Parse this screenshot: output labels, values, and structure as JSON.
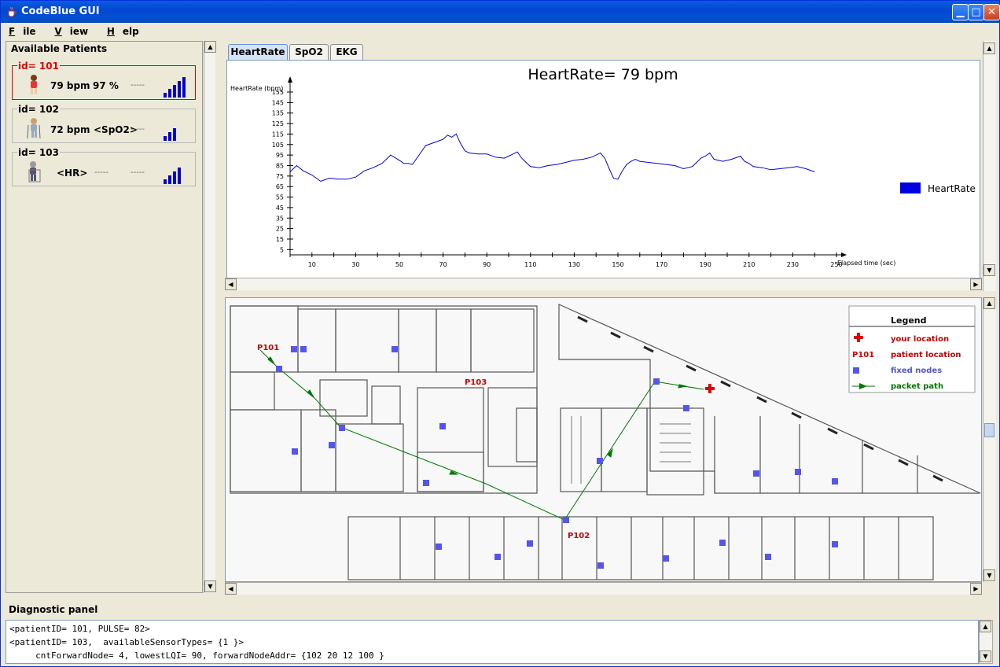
{
  "window": {
    "title": "CodeBlue GUI"
  },
  "menu": [
    {
      "label": "File",
      "u": "F",
      "rest": "ile"
    },
    {
      "label": "View",
      "u": "V",
      "rest": "iew"
    },
    {
      "label": "Help",
      "u": "H",
      "rest": "elp"
    }
  ],
  "patients_panel": {
    "title": "Available Patients",
    "patients": [
      {
        "id_label": "id= 101",
        "value1": "79 bpm",
        "value2": "97 %",
        "value3": "-----",
        "signal_bars": 5,
        "selected": true
      },
      {
        "id_label": "id= 102",
        "value1": "72 bpm",
        "value2": "<SpO2>",
        "value3": "-----",
        "signal_bars": 3,
        "selected": false
      },
      {
        "id_label": "id= 103",
        "value1": "<HR>",
        "value2": "-----",
        "value3": "-----",
        "signal_bars": 4,
        "selected": false
      }
    ]
  },
  "tabs": [
    {
      "label": "HeartRate",
      "active": true
    },
    {
      "label": "SpO2",
      "active": false
    },
    {
      "label": "EKG",
      "active": false
    }
  ],
  "chart_data": {
    "type": "line",
    "title": "HeartRate= 79 bpm",
    "ylabel": "HeartRate (bpm)",
    "xlabel": "Elapsed time (sec)",
    "xlim": [
      0,
      250
    ],
    "ylim": [
      0,
      155
    ],
    "yticks": [
      5,
      15,
      25,
      35,
      45,
      55,
      65,
      75,
      85,
      95,
      105,
      115,
      125,
      135,
      145,
      155
    ],
    "xticks": [
      10,
      30,
      50,
      70,
      90,
      110,
      130,
      150,
      170,
      190,
      210,
      230,
      250
    ],
    "legend": "right",
    "series": [
      {
        "name": "HeartRate",
        "color": "#0000e0",
        "x": [
          0,
          3,
          6,
          10,
          14,
          18,
          22,
          26,
          30,
          34,
          38,
          42,
          46,
          50,
          52,
          54,
          56,
          58,
          62,
          66,
          70,
          72,
          74,
          76,
          78,
          80,
          82,
          86,
          90,
          94,
          98,
          100,
          102,
          104,
          106,
          108,
          110,
          114,
          118,
          122,
          126,
          130,
          134,
          138,
          142,
          144,
          146,
          148,
          150,
          152,
          154,
          156,
          158,
          160,
          164,
          168,
          172,
          176,
          180,
          184,
          186,
          188,
          190,
          192,
          194,
          198,
          202,
          206,
          208,
          210,
          212,
          216,
          220,
          224,
          228,
          232,
          236,
          240
        ],
        "y": [
          79,
          85,
          80,
          76,
          70,
          73,
          72,
          72,
          74,
          80,
          83,
          87,
          95,
          90,
          87,
          87,
          86,
          92,
          104,
          107,
          110,
          114,
          112,
          115,
          106,
          99,
          97,
          96,
          96,
          93,
          92,
          94,
          96,
          98,
          92,
          88,
          84,
          83,
          85,
          86,
          88,
          90,
          91,
          93,
          97,
          92,
          82,
          73,
          72,
          80,
          86,
          89,
          91,
          89,
          88,
          87,
          86,
          85,
          82,
          84,
          88,
          92,
          94,
          97,
          91,
          89,
          91,
          94,
          89,
          87,
          84,
          83,
          81,
          82,
          83,
          84,
          82,
          79
        ]
      }
    ]
  },
  "map": {
    "legend_title": "Legend",
    "legend_items": [
      {
        "symbol": "cross",
        "label": "your location",
        "color": "#e00000"
      },
      {
        "symbol": "text",
        "symbol_text": "P101",
        "label": "patient location",
        "color": "#cc0000"
      },
      {
        "symbol": "square",
        "label": "fixed nodes",
        "color": "#5555dd"
      },
      {
        "symbol": "arrow",
        "label": "packet path",
        "color": "#007700"
      }
    ],
    "patient_labels": [
      "P101",
      "P103",
      "P102"
    ]
  },
  "diagnostic": {
    "title": "Diagnostic panel",
    "lines": [
      "<patientID= 101, PULSE= 82>",
      "<patientID= 103,  availableSensorTypes= {1 }>",
      "     cntForwardNode= 4, lowestLQI= 90, forwardNodeAddr= {102 20 12 100 }"
    ]
  }
}
